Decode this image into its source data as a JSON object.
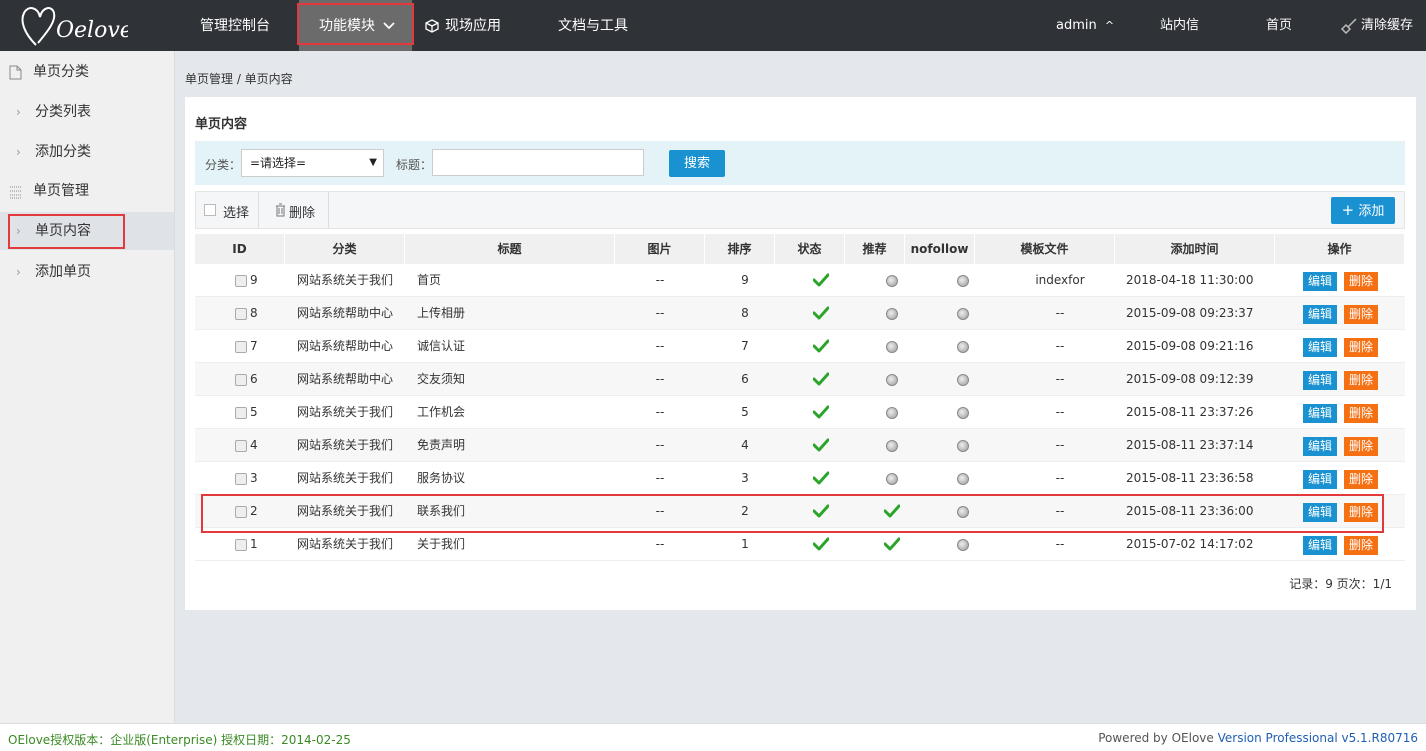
{
  "logo": {
    "text": "Oelove"
  },
  "nav": {
    "items": [
      {
        "label": "管理控制台"
      },
      {
        "label": "功能模块"
      },
      {
        "label": "现场应用"
      },
      {
        "label": "文档与工具"
      }
    ],
    "user": "admin",
    "messages": "站内信",
    "home": "首页",
    "clear_cache": "清除缓存"
  },
  "sidebar": {
    "sections": [
      {
        "title": "单页分类",
        "items": [
          {
            "label": "分类列表"
          },
          {
            "label": "添加分类"
          }
        ]
      },
      {
        "title": "单页管理",
        "items": [
          {
            "label": "单页内容"
          },
          {
            "label": "添加单页"
          }
        ]
      }
    ],
    "active_item": "单页内容"
  },
  "breadcrumb": "单页管理 / 单页内容",
  "panel": {
    "title": "单页内容"
  },
  "filter": {
    "category_label": "分类：",
    "category_value": "=请选择=",
    "title_label": "标题：",
    "title_value": "",
    "search_button": "搜索"
  },
  "toolbar": {
    "select_label": "选择",
    "delete_label": "删除",
    "add_label": "添加"
  },
  "table": {
    "columns": [
      "ID",
      "分类",
      "标题",
      "图片",
      "排序",
      "状态",
      "推荐",
      "nofollow",
      "模板文件",
      "添加时间",
      "操作"
    ],
    "rows": [
      {
        "id": "9",
        "category": "网站系统关于我们",
        "title": "首页",
        "image": "--",
        "order": "9",
        "status": true,
        "recommend": false,
        "nofollow": false,
        "template": "indexfor",
        "added": "2018-04-18 11:30:00"
      },
      {
        "id": "8",
        "category": "网站系统帮助中心",
        "title": "上传相册",
        "image": "--",
        "order": "8",
        "status": true,
        "recommend": false,
        "nofollow": false,
        "template": "--",
        "added": "2015-09-08 09:23:37"
      },
      {
        "id": "7",
        "category": "网站系统帮助中心",
        "title": "诚信认证",
        "image": "--",
        "order": "7",
        "status": true,
        "recommend": false,
        "nofollow": false,
        "template": "--",
        "added": "2015-09-08 09:21:16"
      },
      {
        "id": "6",
        "category": "网站系统帮助中心",
        "title": "交友须知",
        "image": "--",
        "order": "6",
        "status": true,
        "recommend": false,
        "nofollow": false,
        "template": "--",
        "added": "2015-09-08 09:12:39"
      },
      {
        "id": "5",
        "category": "网站系统关于我们",
        "title": "工作机会",
        "image": "--",
        "order": "5",
        "status": true,
        "recommend": false,
        "nofollow": false,
        "template": "--",
        "added": "2015-08-11 23:37:26"
      },
      {
        "id": "4",
        "category": "网站系统关于我们",
        "title": "免责声明",
        "image": "--",
        "order": "4",
        "status": true,
        "recommend": false,
        "nofollow": false,
        "template": "--",
        "added": "2015-08-11 23:37:14"
      },
      {
        "id": "3",
        "category": "网站系统关于我们",
        "title": "服务协议",
        "image": "--",
        "order": "3",
        "status": true,
        "recommend": false,
        "nofollow": false,
        "template": "--",
        "added": "2015-08-11 23:36:58"
      },
      {
        "id": "2",
        "category": "网站系统关于我们",
        "title": "联系我们",
        "image": "--",
        "order": "2",
        "status": true,
        "recommend": true,
        "nofollow": false,
        "template": "--",
        "added": "2015-08-11 23:36:00"
      },
      {
        "id": "1",
        "category": "网站系统关于我们",
        "title": "关于我们",
        "image": "--",
        "order": "1",
        "status": true,
        "recommend": true,
        "nofollow": false,
        "template": "--",
        "added": "2015-07-02 14:17:02"
      }
    ],
    "edit_label": "编辑",
    "delete_label": "删除"
  },
  "pager": "记录：9   页次：1/1",
  "footer": {
    "license": "OElove授权版本：企业版(Enterprise) 授权日期：2014-02-25",
    "powered_prefix": "Powered by OElove",
    "version": "Version Professional v5.1.R80716"
  },
  "colors": {
    "topbar": "#2f3236",
    "accent": "#1a91d0",
    "danger": "#f57013",
    "highlight": "#e3393c",
    "ok": "#2aa52a"
  }
}
